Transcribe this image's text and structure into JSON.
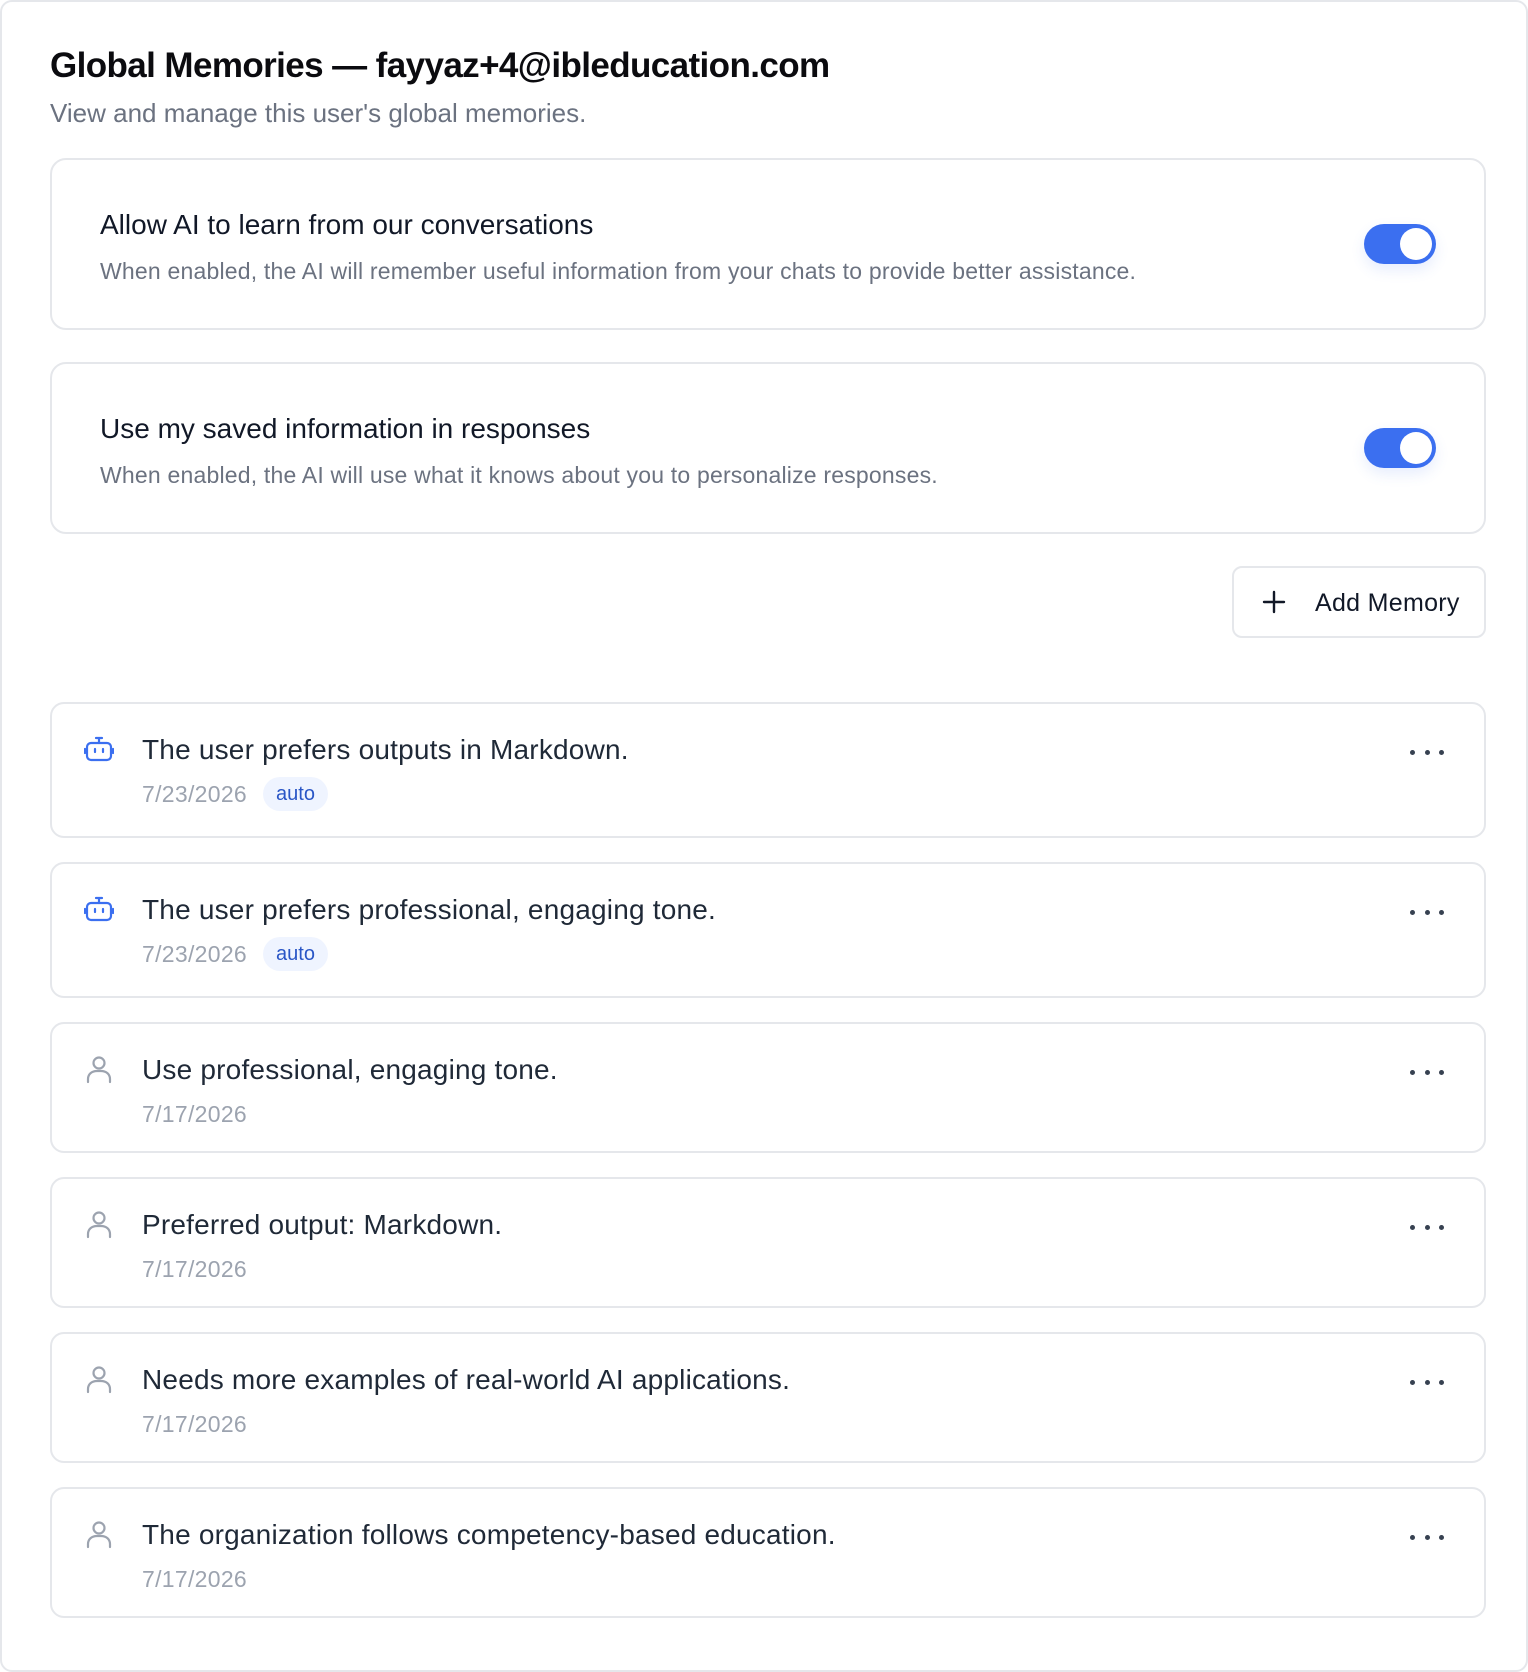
{
  "header": {
    "title": "Global Memories — fayyaz+4@ibleducation.com",
    "subtitle": "View and manage this user's global memories."
  },
  "settings": [
    {
      "title": "Allow AI to learn from our conversations",
      "description": "When enabled, the AI will remember useful information from your chats to provide better assistance.",
      "enabled": true
    },
    {
      "title": "Use my saved information in responses",
      "description": "When enabled, the AI will use what it knows about you to personalize responses.",
      "enabled": true
    }
  ],
  "actions": {
    "add_memory_label": "Add Memory",
    "add_icon": "plus-icon"
  },
  "memories": [
    {
      "text": "The user prefers outputs in Markdown.",
      "date": "7/23/2026",
      "badge": "auto",
      "icon": "robot-icon"
    },
    {
      "text": "The user prefers professional, engaging tone.",
      "date": "7/23/2026",
      "badge": "auto",
      "icon": "robot-icon"
    },
    {
      "text": "Use professional, engaging tone.",
      "date": "7/17/2026",
      "icon": "user-icon"
    },
    {
      "text": "Preferred output: Markdown.",
      "date": "7/17/2026",
      "icon": "user-icon"
    },
    {
      "text": "Needs more examples of real-world AI applications.",
      "date": "7/17/2026",
      "icon": "user-icon"
    },
    {
      "text": "The organization follows competency-based education.",
      "date": "7/17/2026",
      "icon": "user-icon"
    }
  ],
  "colors": {
    "accent": "#3b6ff0",
    "badge_bg": "#eff4ff",
    "badge_text": "#2a56c6",
    "border": "#e5e7eb",
    "muted_text": "#6b7280"
  }
}
